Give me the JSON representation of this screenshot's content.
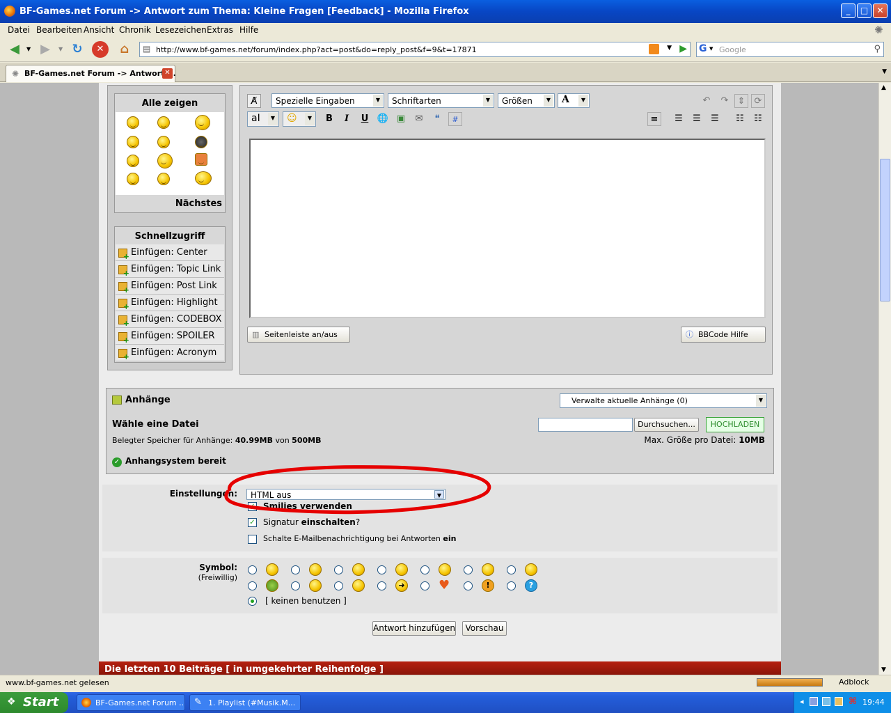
{
  "window": {
    "title": "BF-Games.net Forum -> Antwort zum Thema: Kleine Fragen [Feedback] - Mozilla Firefox"
  },
  "menu": [
    "Datei",
    "Bearbeiten",
    "Ansicht",
    "Chronik",
    "Lesezeichen",
    "Extras",
    "Hilfe"
  ],
  "urlbar": {
    "url": "http://www.bf-games.net/forum/index.php?act=post&do=reply_post&f=9&t=17871"
  },
  "search": {
    "placeholder": "Google"
  },
  "tab": {
    "label": "BF-Games.net Forum -> Antwort ..."
  },
  "smilies_panel": {
    "show_all": "Alle zeigen",
    "next": "Nächstes"
  },
  "quick_access": {
    "title": "Schnellzugriff",
    "items": [
      "Einfügen: Center",
      "Einfügen: Topic Link",
      "Einfügen: Post Link",
      "Einfügen: Highlight",
      "Einfügen: CODEBOX",
      "Einfügen: SPOILER",
      "Einfügen: Acronym"
    ]
  },
  "editor": {
    "special": "Spezielle Eingaben",
    "fonts": "Schriftarten",
    "sizes": "Größen",
    "sidebar_toggle": "Seitenleiste an/aus",
    "bbcode_help": "BBCode Hilfe"
  },
  "attachments": {
    "title": "Anhänge",
    "manage": "Verwalte aktuelle Anhänge (0)",
    "choose": "Wähle eine Datei",
    "browse": "Durchsuchen...",
    "upload": "HOCHLADEN",
    "used_label": "Belegter Speicher für Anhänge:",
    "used": "40.99MB",
    "of": "von",
    "total": "500MB",
    "max_label": "Max. Größe pro Datei:",
    "max": "10MB",
    "ready": "Anhangsystem bereit"
  },
  "settings": {
    "label": "Einstellungen:",
    "html": "HTML aus",
    "smilies": "Smilies verwenden",
    "signature_a": "Signatur",
    "signature_b": "einschalten",
    "signature_c": "?",
    "email_a": "Schalte E-Mailbenachrichtigung bei Antworten",
    "email_b": "ein"
  },
  "symbol": {
    "label": "Symbol:",
    "sub": "(Freiwillig)",
    "none": "[ keinen benutzen ]"
  },
  "buttons": {
    "submit": "Antwort hinzufügen",
    "preview": "Vorschau"
  },
  "last_posts": "Die letzten 10 Beiträge [ in umgekehrter Reihenfolge ]",
  "status": {
    "text": "www.bf-games.net gelesen",
    "adblock": "Adblock"
  },
  "taskbar": {
    "start": "Start",
    "task1": "BF-Games.net Forum ...",
    "task2": "1. Playlist (#Musik.M...",
    "clock": "19:44"
  },
  "colors": {
    "accent_red": "#a51c0e",
    "upload_green": "#3da53d"
  }
}
